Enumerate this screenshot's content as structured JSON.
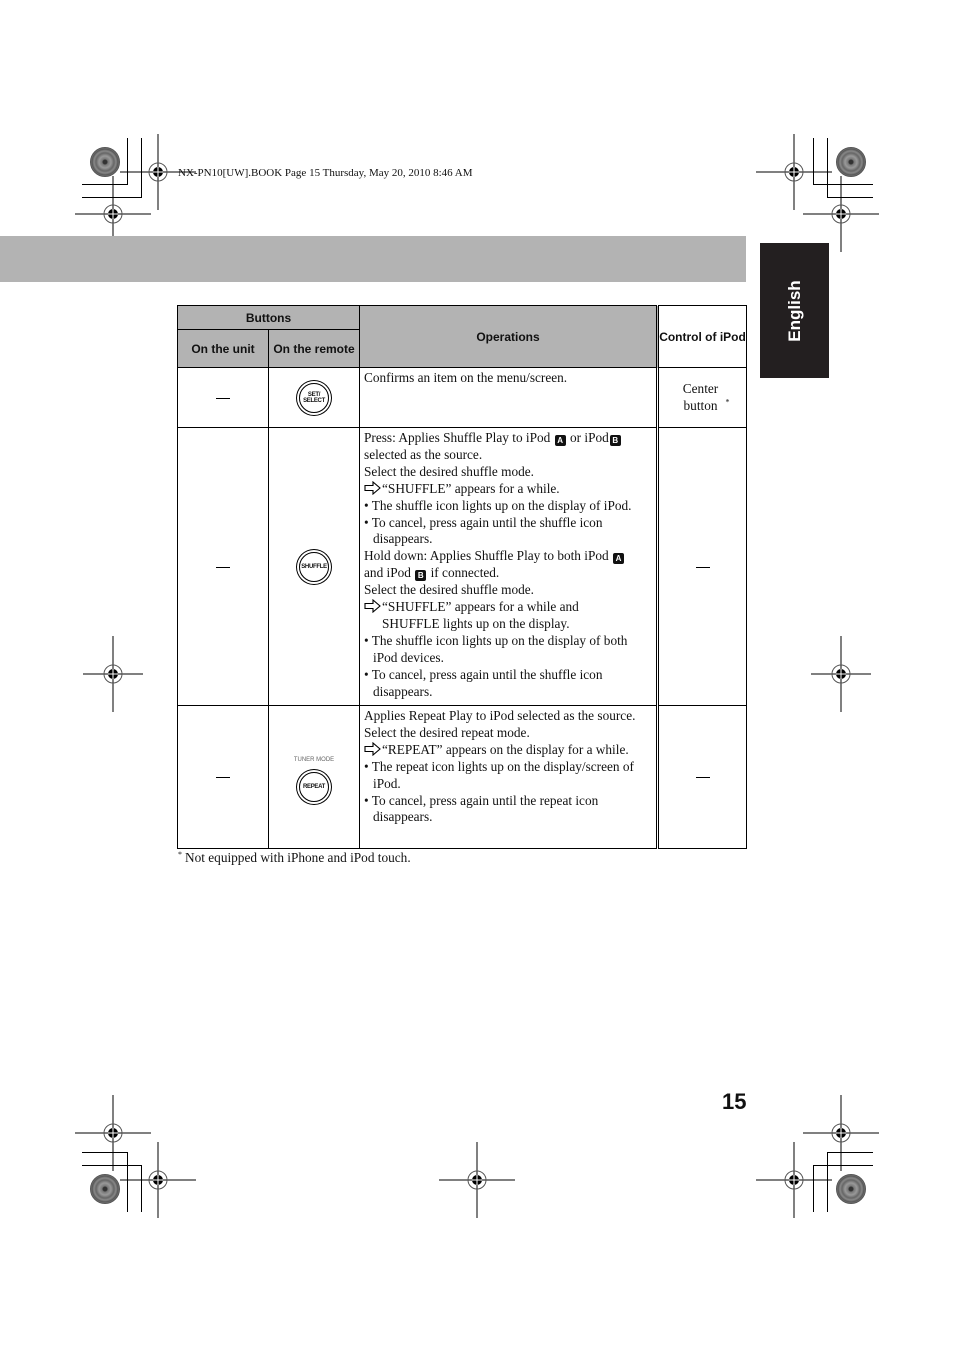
{
  "book_header": "NX-PN10[UW].BOOK  Page 15  Thursday, May 20, 2010  8:46 AM",
  "language_tab": "English",
  "table": {
    "headers": {
      "buttons": "Buttons",
      "on_the_unit": "On the unit",
      "on_the_remote": "On the remote",
      "operations": "Operations",
      "control_of_ipod": "Control of iPod"
    },
    "rows": [
      {
        "on_the_unit": "—",
        "remote_button": {
          "label_line1": "SET/",
          "label_line2": "SELECT",
          "caption": "",
          "icon": "set-select-button-icon"
        },
        "operations": [
          "Confirms an item on the menu/screen."
        ],
        "control_of_ipod": "Center button",
        "control_footnote_mark": "*"
      },
      {
        "on_the_unit": "—",
        "remote_button": {
          "label_line1": "SHUFFLE",
          "label_line2": "",
          "caption": "",
          "icon": "shuffle-button-icon"
        },
        "operations": {
          "press_1": "Press: Applies Shuffle Play to iPod",
          "press_2": "or iPod",
          "press_3": "selected as the source.",
          "press_select": "Select the desired shuffle mode.",
          "press_result": "“SHUFFLE” appears for a while.",
          "press_bullet_1": "• The shuffle icon lights up on the display of  iPod.",
          "press_bullet_2": "• To cancel, press again until the shuffle icon disappears.",
          "hold_1": "Hold down: Applies Shuffle Play to both iPod",
          "hold_2": "and iPod",
          "hold_3": "if connected.",
          "hold_select": "Select the desired shuffle mode.",
          "hold_result_1": "“SHUFFLE” appears for a while and",
          "hold_result_2": "SHUFFLE lights up on the display.",
          "hold_bullet_1": "• The shuffle icon lights up on the display of both iPod devices.",
          "hold_bullet_2": "• To cancel, press again until the shuffle icon disappears.",
          "ipod_a": "A",
          "ipod_b": "B"
        },
        "control_of_ipod": "—"
      },
      {
        "on_the_unit": "—",
        "remote_button": {
          "label_line1": "REPEAT",
          "label_line2": "",
          "caption": "TUNER MODE",
          "icon": "repeat-button-icon"
        },
        "operations": {
          "line_1": "Applies Repeat Play to iPod selected as the source.",
          "select": "Select the desired repeat mode.",
          "result": "“REPEAT” appears on the display for a while.",
          "bullet_1": "• The repeat icon lights up on the display/screen of iPod.",
          "bullet_2": "• To cancel, press again until the repeat icon disappears."
        },
        "control_of_ipod": "—"
      }
    ]
  },
  "footnote": {
    "mark": "*",
    "text": "Not equipped with iPhone and iPod touch."
  },
  "page_number": "15"
}
